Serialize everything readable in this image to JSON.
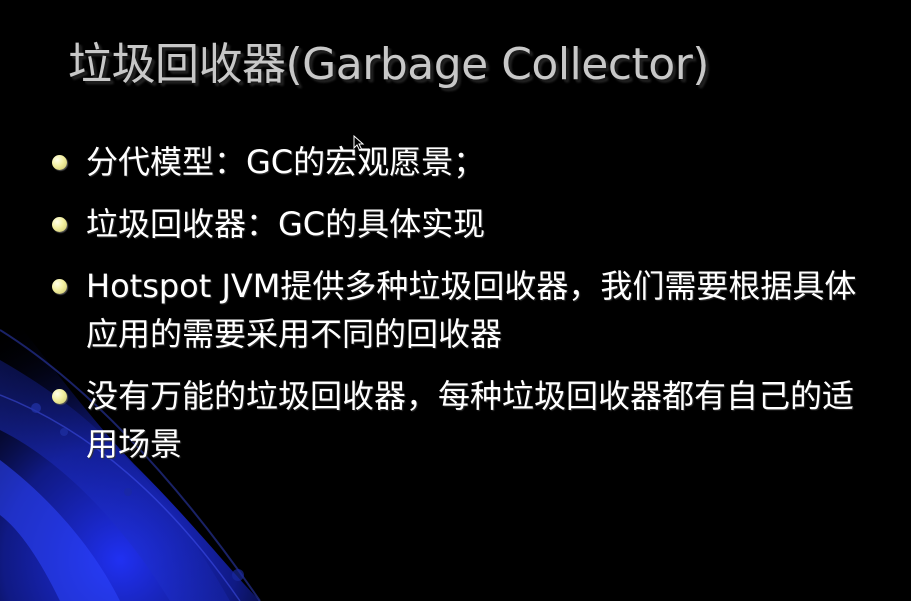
{
  "slide": {
    "title": "垃圾回收器(Garbage Collector)",
    "bullets": [
      {
        "text": "分代模型：GC的宏观愿景；"
      },
      {
        "text": "垃圾回收器：GC的具体实现"
      },
      {
        "text": "Hotspot JVM提供多种垃圾回收器，我们需要根据具体应用的需要采用不同的回收器"
      },
      {
        "text": "没有万能的垃圾回收器，每种垃圾回收器都有自己的适用场景"
      }
    ]
  },
  "colors": {
    "background": "#000000",
    "title": "#c8c8c8",
    "text": "#ffffff",
    "bullet": "#f2efa0",
    "accent_blue": "#1a2fd0"
  },
  "icons": {
    "bullet": "bullet-dot-icon",
    "cursor": "mouse-cursor-icon"
  }
}
